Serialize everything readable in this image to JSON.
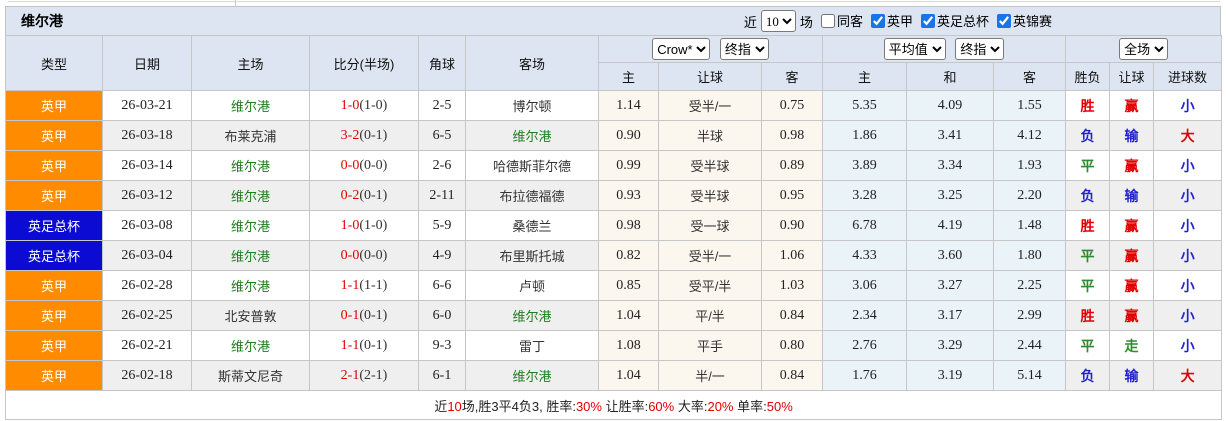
{
  "title": "维尔港",
  "controls": {
    "near_label": "近",
    "matches_count": "10",
    "matches_suffix": "场",
    "checkboxes": [
      {
        "label": "同客",
        "checked": false
      },
      {
        "label": "英甲",
        "checked": true
      },
      {
        "label": "英足总杯",
        "checked": true
      },
      {
        "label": "英锦赛",
        "checked": true
      }
    ]
  },
  "header": {
    "left_cols": [
      "类型",
      "日期",
      "主场",
      "比分(半场)",
      "角球",
      "客场"
    ],
    "odds_selects": [
      "Crow*",
      "终指"
    ],
    "avg_selects": [
      "平均值",
      "终指"
    ],
    "scope_select": "全场",
    "odds_subcols": [
      "主",
      "让球",
      "客"
    ],
    "avg_subcols": [
      "主",
      "和",
      "客"
    ],
    "result_subcols": [
      "胜负",
      "让球",
      "进球数"
    ]
  },
  "colors": {
    "league_bg": {
      "英甲": "#ff8c00",
      "英足总杯": "#0b0bd3"
    },
    "outcome": {
      "胜": "#e10000",
      "平": "#2e8b2e",
      "负": "#2424d2",
      "赢": "#e10000",
      "输": "#2424d2",
      "走": "#2e8b2e",
      "大": "#e10000",
      "小": "#2424d2"
    },
    "team_highlight": "#1e7d1e",
    "score_main": "#e10000",
    "header_bg": "#dce5f1",
    "odds_bg": "#fbf6ee",
    "avg_bg": "#eaf3f8",
    "zebra_bg": "#efefef"
  },
  "rows": [
    {
      "league": "英甲",
      "date": "26-03-21",
      "home": "维尔港",
      "score": "1-0",
      "half": "(1-0)",
      "corner": "2-5",
      "away": "博尔顿",
      "odds": [
        "1.14",
        "受半/一",
        "0.75"
      ],
      "avg": [
        "5.35",
        "4.09",
        "1.55"
      ],
      "outcome": [
        "胜",
        "赢",
        "小"
      ]
    },
    {
      "league": "英甲",
      "date": "26-03-18",
      "home": "布莱克浦",
      "score": "3-2",
      "half": "(0-1)",
      "corner": "6-5",
      "away": "维尔港",
      "odds": [
        "0.90",
        "半球",
        "0.98"
      ],
      "avg": [
        "1.86",
        "3.41",
        "4.12"
      ],
      "outcome": [
        "负",
        "输",
        "大"
      ]
    },
    {
      "league": "英甲",
      "date": "26-03-14",
      "home": "维尔港",
      "score": "0-0",
      "half": "(0-0)",
      "corner": "2-6",
      "away": "哈德斯菲尔德",
      "odds": [
        "0.99",
        "受半球",
        "0.89"
      ],
      "avg": [
        "3.89",
        "3.34",
        "1.93"
      ],
      "outcome": [
        "平",
        "赢",
        "小"
      ]
    },
    {
      "league": "英甲",
      "date": "26-03-12",
      "home": "维尔港",
      "score": "0-2",
      "half": "(0-1)",
      "corner": "2-11",
      "away": "布拉德福德",
      "odds": [
        "0.93",
        "受半球",
        "0.95"
      ],
      "avg": [
        "3.28",
        "3.25",
        "2.20"
      ],
      "outcome": [
        "负",
        "输",
        "小"
      ]
    },
    {
      "league": "英足总杯",
      "date": "26-03-08",
      "home": "维尔港",
      "score": "1-0",
      "half": "(1-0)",
      "corner": "5-9",
      "away": "桑德兰",
      "odds": [
        "0.98",
        "受一球",
        "0.90"
      ],
      "avg": [
        "6.78",
        "4.19",
        "1.48"
      ],
      "outcome": [
        "胜",
        "赢",
        "小"
      ]
    },
    {
      "league": "英足总杯",
      "date": "26-03-04",
      "home": "维尔港",
      "score": "0-0",
      "half": "(0-0)",
      "corner": "4-9",
      "away": "布里斯托城",
      "odds": [
        "0.82",
        "受半/一",
        "1.06"
      ],
      "avg": [
        "4.33",
        "3.60",
        "1.80"
      ],
      "outcome": [
        "平",
        "赢",
        "小"
      ]
    },
    {
      "league": "英甲",
      "date": "26-02-28",
      "home": "维尔港",
      "score": "1-1",
      "half": "(1-1)",
      "corner": "6-6",
      "away": "卢顿",
      "odds": [
        "0.85",
        "受平/半",
        "1.03"
      ],
      "avg": [
        "3.06",
        "3.27",
        "2.25"
      ],
      "outcome": [
        "平",
        "赢",
        "小"
      ]
    },
    {
      "league": "英甲",
      "date": "26-02-25",
      "home": "北安普敦",
      "score": "0-1",
      "half": "(0-1)",
      "corner": "6-0",
      "away": "维尔港",
      "odds": [
        "1.04",
        "平/半",
        "0.84"
      ],
      "avg": [
        "2.34",
        "3.17",
        "2.99"
      ],
      "outcome": [
        "胜",
        "赢",
        "小"
      ]
    },
    {
      "league": "英甲",
      "date": "26-02-21",
      "home": "维尔港",
      "score": "1-1",
      "half": "(0-1)",
      "corner": "9-3",
      "away": "雷丁",
      "odds": [
        "1.08",
        "平手",
        "0.80"
      ],
      "avg": [
        "2.76",
        "3.29",
        "2.44"
      ],
      "outcome": [
        "平",
        "走",
        "小"
      ]
    },
    {
      "league": "英甲",
      "date": "26-02-18",
      "home": "斯蒂文尼奇",
      "score": "2-1",
      "half": "(2-1)",
      "corner": "6-1",
      "away": "维尔港",
      "odds": [
        "1.04",
        "半/一",
        "0.84"
      ],
      "avg": [
        "1.76",
        "3.19",
        "5.14"
      ],
      "outcome": [
        "负",
        "输",
        "大"
      ]
    }
  ],
  "footer": {
    "segments": [
      {
        "text": "近",
        "red": false
      },
      {
        "text": "10",
        "red": true
      },
      {
        "text": "场,胜3平4负3, 胜率:",
        "red": false
      },
      {
        "text": "30%",
        "red": true
      },
      {
        "text": " 让胜率:",
        "red": false
      },
      {
        "text": "60%",
        "red": true
      },
      {
        "text": " 大率:",
        "red": false
      },
      {
        "text": "20%",
        "red": true
      },
      {
        "text": " 单率:",
        "red": false
      },
      {
        "text": "50%",
        "red": true
      }
    ]
  }
}
